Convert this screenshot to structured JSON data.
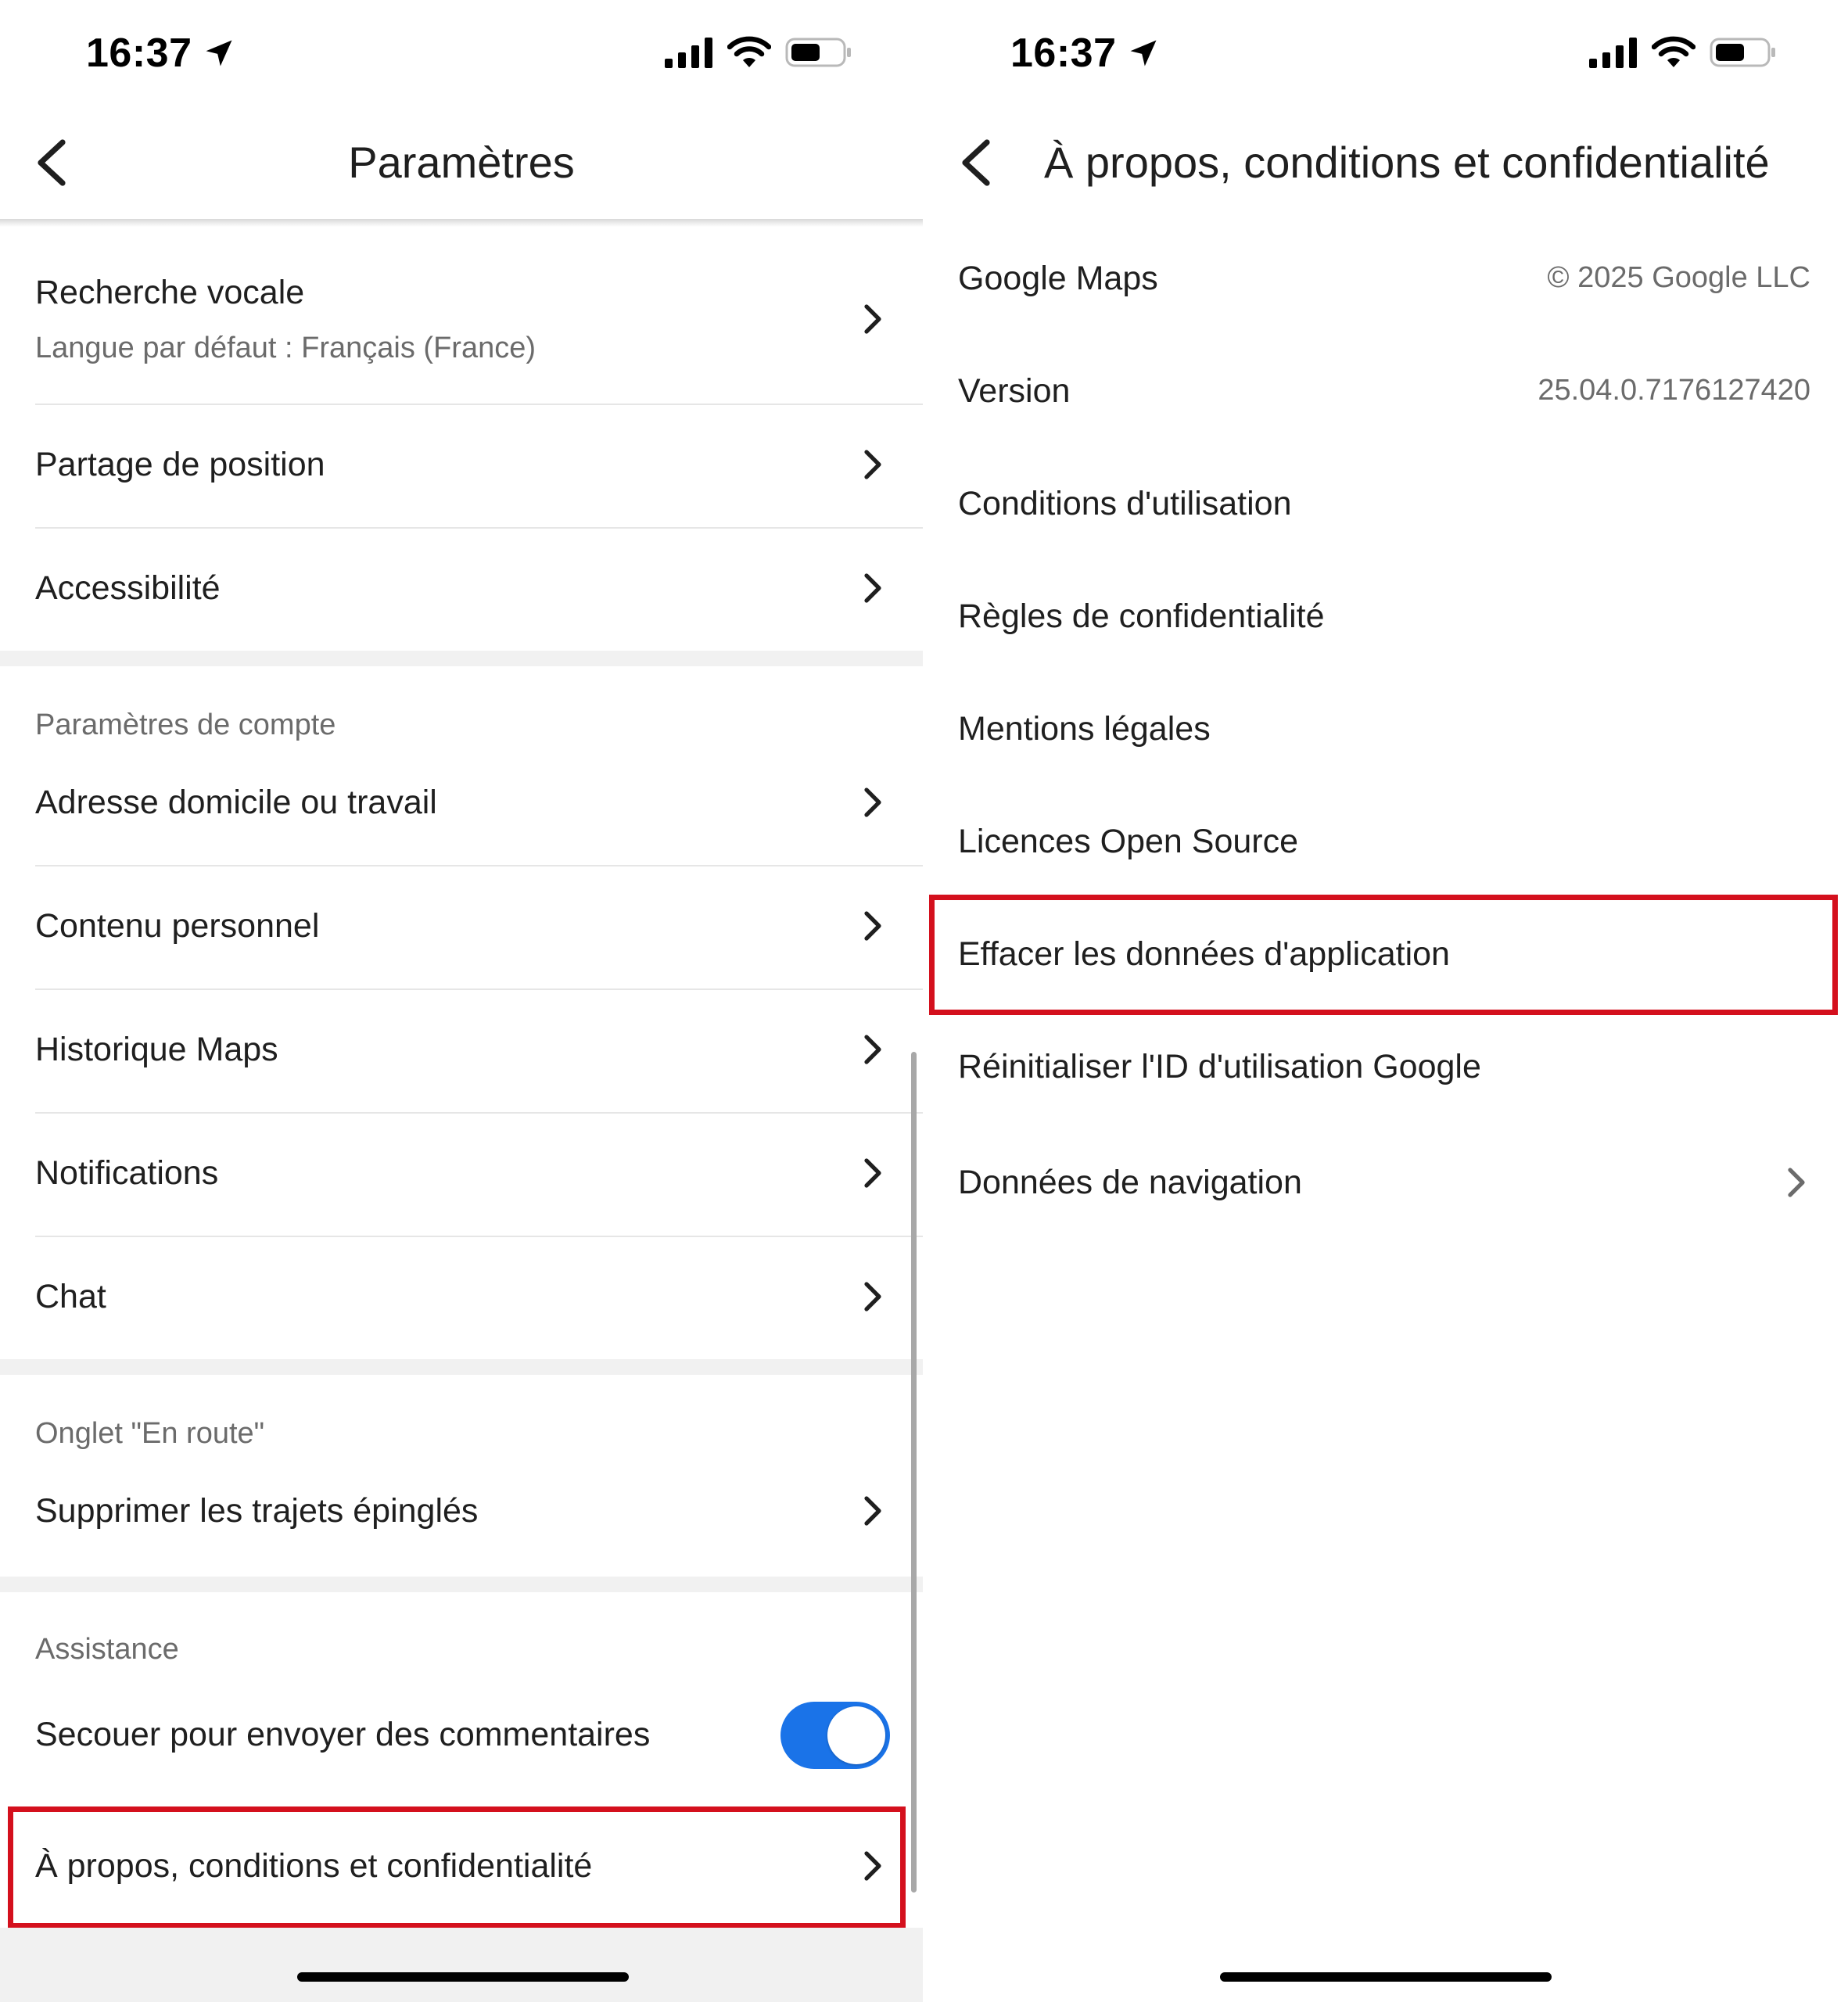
{
  "left_screen": {
    "status": {
      "time": "16:37"
    },
    "header": {
      "title": "Paramètres"
    },
    "items": {
      "voice_search": {
        "label": "Recherche vocale",
        "sub": "Langue par défaut : Français (France)"
      },
      "location_sharing": {
        "label": "Partage de position"
      },
      "accessibility": {
        "label": "Accessibilité"
      },
      "account_section": "Paramètres de compte",
      "home_work": {
        "label": "Adresse domicile ou travail"
      },
      "personal_content": {
        "label": "Contenu personnel"
      },
      "maps_history": {
        "label": "Historique Maps"
      },
      "notifications": {
        "label": "Notifications"
      },
      "chat": {
        "label": "Chat"
      },
      "commute_section": "Onglet \"En route\"",
      "pinned_trips": {
        "label": "Supprimer les trajets épinglés"
      },
      "support_section": "Assistance",
      "shake_feedback": {
        "label": "Secouer pour envoyer des commentaires",
        "toggle": "on"
      },
      "about": {
        "label": "À propos, conditions et confidentialité"
      }
    }
  },
  "right_screen": {
    "status": {
      "time": "16:37"
    },
    "header": {
      "title": "À propos, conditions et confidentialité"
    },
    "items": [
      {
        "label": "Google Maps",
        "value": "© 2025 Google LLC"
      },
      {
        "label": "Version",
        "value": "25.04.0.7176127420"
      },
      {
        "label": "Conditions d'utilisation"
      },
      {
        "label": "Règles de confidentialité"
      },
      {
        "label": "Mentions légales"
      },
      {
        "label": "Licences Open Source"
      },
      {
        "label": "Effacer les données d'application"
      },
      {
        "label": "Réinitialiser l'ID d'utilisation Google"
      },
      {
        "label": "Données de navigation"
      }
    ]
  },
  "colors": {
    "highlight": "#d4101d",
    "toggle_on": "#1a73e8"
  },
  "icons": [
    "location-arrow-icon",
    "signal-icon",
    "wifi-icon",
    "battery-icon",
    "back-chevron-icon",
    "chevron-right-icon"
  ]
}
